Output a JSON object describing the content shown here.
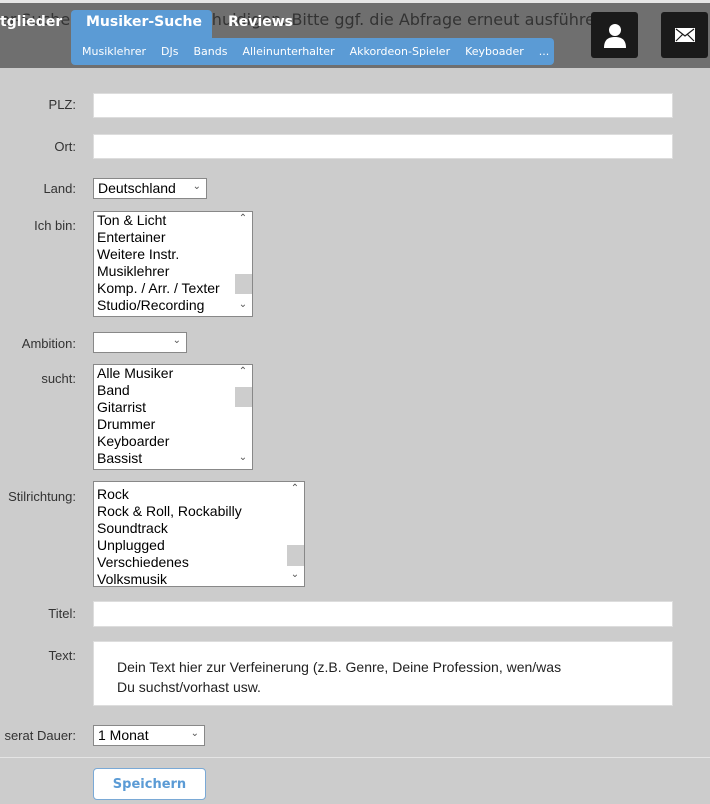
{
  "header": {
    "bg_message_left": "er-Suche",
    "bg_message_right": "chuldigen. Bitte ggf. die Abfrage erneut ausführe",
    "nav": [
      "tglieder",
      "Musiker-Suche",
      "Reviews"
    ],
    "subnav": [
      "Musiklehrer",
      "DJs",
      "Bands",
      "Alleinunterhalter",
      "Akkordeon-Spieler",
      "Keyboader",
      "..."
    ],
    "icons": [
      "user-icon",
      "mail-icon"
    ]
  },
  "form": {
    "plz_label": "PLZ:",
    "plz_value": "",
    "ort_label": "Ort:",
    "ort_value": "",
    "land_label": "Land:",
    "land_value": "Deutschland",
    "ichbin_label": "Ich bin:",
    "ichbin_options": [
      "Ton & Licht",
      "Entertainer",
      "Weitere Instr.",
      "Musiklehrer",
      "Komp. / Arr. / Texter",
      "Studio/Recording"
    ],
    "ambition_label": "Ambition:",
    "ambition_value": "",
    "sucht_label": "sucht:",
    "sucht_options": [
      "Alle Musiker",
      "Band",
      "Gitarrist",
      "Drummer",
      "Keyboarder",
      "Bassist"
    ],
    "stil_label": "Stilrichtung:",
    "stil_options": [
      "Rock",
      "Rock & Roll, Rockabilly",
      "Soundtrack",
      "Unplugged",
      "Verschiedenes",
      "Volksmusik"
    ],
    "titel_label": "Titel:",
    "titel_value": "",
    "text_label": "Text:",
    "text_placeholder": "Dein Text hier zur Verfeinerung (z.B. Genre, Deine Profession, wen/was Du suchst/vorhast usw.",
    "dauer_label": "serat Dauer:",
    "dauer_value": "1 Monat",
    "save_label": "Speichern"
  }
}
